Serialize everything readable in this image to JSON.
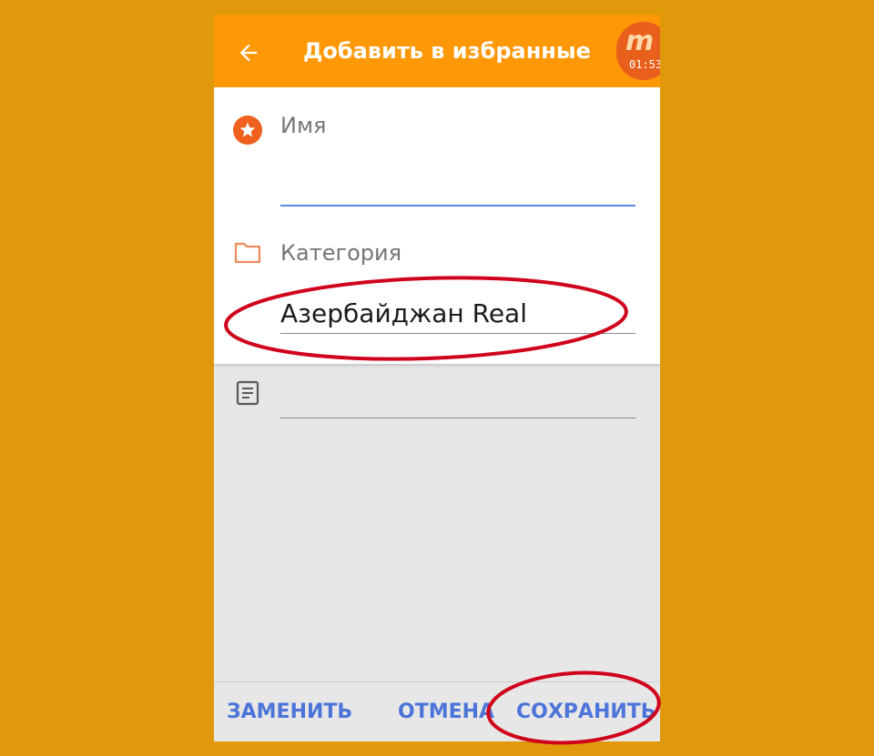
{
  "appbar": {
    "title": "Добавить в избранные",
    "back_icon": "arrow-left-icon",
    "recorder_time": "01:53",
    "recorder_logo": "m"
  },
  "form": {
    "name": {
      "label": "Имя",
      "value": "",
      "icon": "star-circle-icon"
    },
    "category": {
      "label": "Категория",
      "value": "Азербайджан Real",
      "icon": "folder-icon"
    },
    "note": {
      "value": "",
      "icon": "note-icon"
    }
  },
  "actions": {
    "replace": "ЗАМЕНИТЬ",
    "cancel": "ОТМЕНА",
    "save": "СОХРАНИТЬ"
  },
  "colors": {
    "background": "#E1990C",
    "appbar": "#FF9807",
    "accent": "#5E86E0",
    "button_text": "#4C74D9",
    "star": "#F0601E",
    "annotation": "#D0021B"
  }
}
